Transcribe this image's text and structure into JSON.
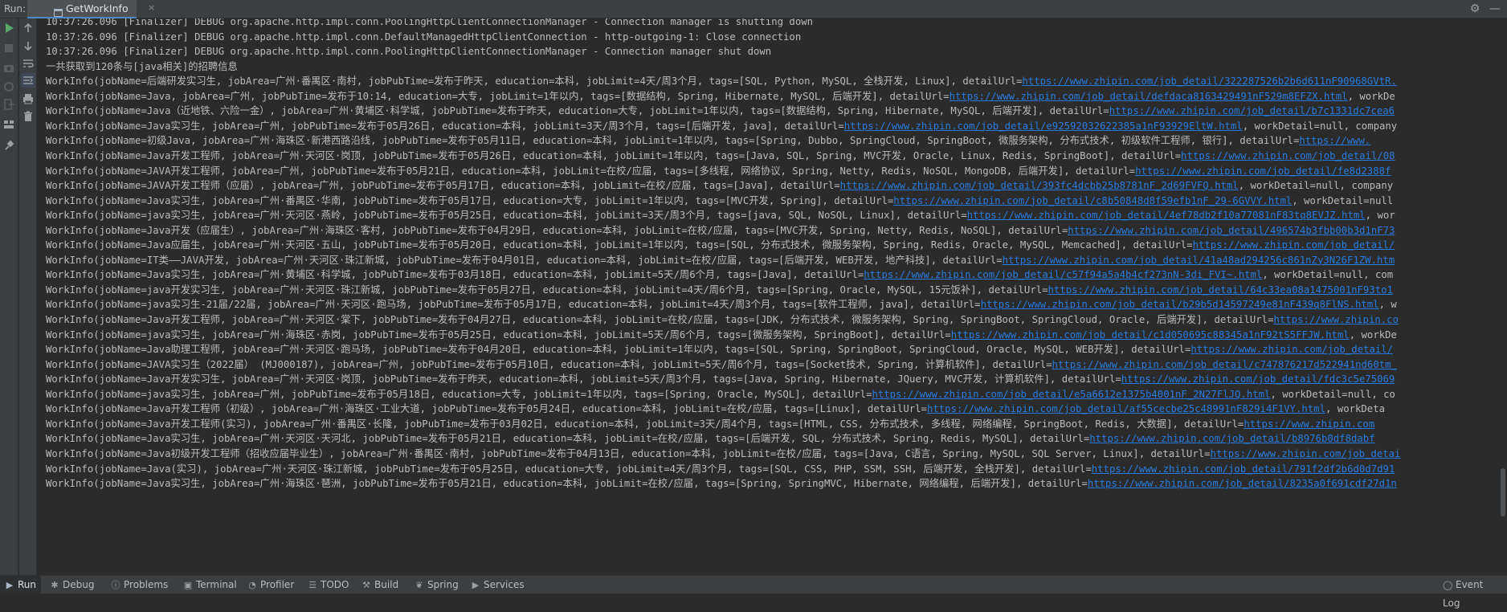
{
  "run_label": "Run:",
  "tab_title": "GetWorkInfo",
  "tab_close": "×",
  "bottom_tabs": [
    {
      "label": "Run",
      "icon": "play-icon"
    },
    {
      "label": "Debug",
      "icon": "bug-icon"
    },
    {
      "label": "Problems",
      "icon": "info-icon"
    },
    {
      "label": "Terminal",
      "icon": "terminal-icon"
    },
    {
      "label": "Profiler",
      "icon": "profiler-icon"
    },
    {
      "label": "TODO",
      "icon": "list-icon"
    },
    {
      "label": "Build",
      "icon": "hammer-icon"
    },
    {
      "label": "Spring",
      "icon": "leaf-icon"
    },
    {
      "label": "Services",
      "icon": "services-icon"
    }
  ],
  "event_log": "Event Log",
  "console_lines": [
    {
      "text": "10:37:26.096 [Finalizer] DEBUG org.apache.http.impl.conn.PoolingHttpClientConnectionManager - Connection manager is shutting down",
      "link": "",
      "after": ""
    },
    {
      "text": "10:37:26.096 [Finalizer] DEBUG org.apache.http.impl.conn.DefaultManagedHttpClientConnection - http-outgoing-1: Close connection",
      "link": "",
      "after": ""
    },
    {
      "text": "10:37:26.096 [Finalizer] DEBUG org.apache.http.impl.conn.PoolingHttpClientConnectionManager - Connection manager shut down",
      "link": "",
      "after": ""
    },
    {
      "text": "一共获取到120条与[java相关]的招聘信息",
      "link": "",
      "after": ""
    },
    {
      "text": "WorkInfo(jobName=后端研发实习生, jobArea=广州·番禺区·南村, jobPubTime=发布于昨天, education=本科, jobLimit=4天/周3个月, tags=[SQL, Python, MySQL, 全栈开发, Linux], detailUrl=",
      "link": "https://www.zhipin.com/job_detail/322287526b2b6d611nF90968GVtR.",
      "after": ""
    },
    {
      "text": "WorkInfo(jobName=Java, jobArea=广州, jobPubTime=发布于10:14, education=大专, jobLimit=1年以内, tags=[数据结构, Spring, Hibernate, MySQL, 后端开发], detailUrl=",
      "link": "https://www.zhipin.com/job_detail/defdaca8163429491nF529m8EFZX.html",
      "after": ", workDe"
    },
    {
      "text": "WorkInfo(jobName=Java（近地铁、六险一金）, jobArea=广州·黄埔区·科学城, jobPubTime=发布于昨天, education=大专, jobLimit=1年以内, tags=[数据结构, Spring, Hibernate, MySQL, 后端开发], detailUrl=",
      "link": "https://www.zhipin.com/job_detail/b7c1331dc7cea6",
      "after": ""
    },
    {
      "text": "WorkInfo(jobName=Java实习生, jobArea=广州, jobPubTime=发布于05月26日, education=本科, jobLimit=3天/周3个月, tags=[后端开发, java], detailUrl=",
      "link": "https://www.zhipin.com/job_detail/e92592032622385a1nF93929EltW.html",
      "after": ", workDetail=null, company"
    },
    {
      "text": "WorkInfo(jobName=初级Java, jobArea=广州·海珠区·新港西路沿线, jobPubTime=发布于05月11日, education=本科, jobLimit=1年以内, tags=[Spring, Dubbo, SpringCloud, SpringBoot, 微服务架构, 分布式技术, 初级软件工程师, 银行], detailUrl=",
      "link": "https://www.",
      "after": ""
    },
    {
      "text": "WorkInfo(jobName=Java开发工程师, jobArea=广州·天河区·岗顶, jobPubTime=发布于05月26日, education=本科, jobLimit=1年以内, tags=[Java, SQL, Spring, MVC开发, Oracle, Linux, Redis, SpringBoot], detailUrl=",
      "link": "https://www.zhipin.com/job_detail/08",
      "after": ""
    },
    {
      "text": "WorkInfo(jobName=JAVA开发工程师, jobArea=广州, jobPubTime=发布于05月21日, education=本科, jobLimit=在校/应届, tags=[多线程, 网络协议, Spring, Netty, Redis, NoSQL, MongoDB, 后端开发], detailUrl=",
      "link": "https://www.zhipin.com/job_detail/fe8d2388f",
      "after": ""
    },
    {
      "text": "WorkInfo(jobName=JAVA开发工程师（应届）, jobArea=广州, jobPubTime=发布于05月17日, education=本科, jobLimit=在校/应届, tags=[Java], detailUrl=",
      "link": "https://www.zhipin.com/job_detail/393fc4dcbb25b8781nF_2d69FVFQ.html",
      "after": ", workDetail=null, company"
    },
    {
      "text": "WorkInfo(jobName=Java实习生, jobArea=广州·番禺区·华南, jobPubTime=发布于05月17日, education=大专, jobLimit=1年以内, tags=[MVC开发, Spring], detailUrl=",
      "link": "https://www.zhipin.com/job_detail/c8b50848d8f59efb1nF_29-6GVVY.html",
      "after": ", workDetail=null"
    },
    {
      "text": "WorkInfo(jobName=java实习生, jobArea=广州·天河区·燕岭, jobPubTime=发布于05月25日, education=本科, jobLimit=3天/周3个月, tags=[java, SQL, NoSQL, Linux], detailUrl=",
      "link": "https://www.zhipin.com/job_detail/4ef78db2f10a77081nF83tq8EVJZ.html",
      "after": ", wor"
    },
    {
      "text": "WorkInfo(jobName=Java开发（应届生）, jobArea=广州·海珠区·客村, jobPubTime=发布于04月29日, education=本科, jobLimit=在校/应届, tags=[MVC开发, Spring, Netty, Redis, NoSQL], detailUrl=",
      "link": "https://www.zhipin.com/job_detail/496574b3fbb00b3d1nF73",
      "after": ""
    },
    {
      "text": "WorkInfo(jobName=Java应届生, jobArea=广州·天河区·五山, jobPubTime=发布于05月20日, education=本科, jobLimit=1年以内, tags=[SQL, 分布式技术, 微服务架构, Spring, Redis, Oracle, MySQL, Memcached], detailUrl=",
      "link": "https://www.zhipin.com/job_detail/",
      "after": ""
    },
    {
      "text": "WorkInfo(jobName=IT类——JAVA开发, jobArea=广州·天河区·珠江新城, jobPubTime=发布于04月01日, education=本科, jobLimit=在校/应届, tags=[后端开发, WEB开发, 地产科技], detailUrl=",
      "link": "https://www.zhipin.com/job_detail/41a48ad294256c861nZy3N26F1ZW.htm",
      "after": ""
    },
    {
      "text": "WorkInfo(jobName=Java实习生, jobArea=广州·黄埔区·科学城, jobPubTime=发布于03月18日, education=本科, jobLimit=5天/周6个月, tags=[Java], detailUrl=",
      "link": "https://www.zhipin.com/job_detail/c57f94a5a4b4cf273nN-3di_FVI~.html",
      "after": ", workDetail=null, com"
    },
    {
      "text": "WorkInfo(jobName=java开发实习生, jobArea=广州·天河区·珠江新城, jobPubTime=发布于05月27日, education=本科, jobLimit=4天/周6个月, tags=[Spring, Oracle, MySQL, 15元饭补], detailUrl=",
      "link": "https://www.zhipin.com/job_detail/64c33ea08a1475001nF93to1",
      "after": ""
    },
    {
      "text": "WorkInfo(jobName=java实习生-21届/22届, jobArea=广州·天河区·跑马场, jobPubTime=发布于05月17日, education=本科, jobLimit=4天/周3个月, tags=[软件工程师, java], detailUrl=",
      "link": "https://www.zhipin.com/job_detail/b29b5d14597249e81nF439q8FlNS.html",
      "after": ", w"
    },
    {
      "text": "WorkInfo(jobName=Java开发工程师, jobArea=广州·天河区·棠下, jobPubTime=发布于04月27日, education=本科, jobLimit=在校/应届, tags=[JDK, 分布式技术, 微服务架构, Spring, SpringBoot, SpringCloud, Oracle, 后端开发], detailUrl=",
      "link": "https://www.zhipin.co",
      "after": ""
    },
    {
      "text": "WorkInfo(jobName=java实习生, jobArea=广州·海珠区·赤岗, jobPubTime=发布于05月25日, education=本科, jobLimit=5天/周6个月, tags=[微服务架构, SpringBoot], detailUrl=",
      "link": "https://www.zhipin.com/job_detail/c1d050695c88345a1nF92tS5FFJW.html",
      "after": ", workDe"
    },
    {
      "text": "WorkInfo(jobName=Java助理工程师, jobArea=广州·天河区·跑马场, jobPubTime=发布于04月20日, education=本科, jobLimit=1年以内, tags=[SQL, Spring, SpringBoot, SpringCloud, Oracle, MySQL, WEB开发], detailUrl=",
      "link": "https://www.zhipin.com/job_detail/",
      "after": ""
    },
    {
      "text": "WorkInfo(jobName=JAVA实习生（2022届） (MJ000187), jobArea=广州, jobPubTime=发布于05月10日, education=本科, jobLimit=5天/周6个月, tags=[Socket技术, Spring, 计算机软件], detailUrl=",
      "link": "https://www.zhipin.com/job_detail/c747876217d522941nd60tm_",
      "after": ""
    },
    {
      "text": "WorkInfo(jobName=Java开发实习生, jobArea=广州·天河区·岗顶, jobPubTime=发布于昨天, education=本科, jobLimit=5天/周3个月, tags=[Java, Spring, Hibernate, JQuery, MVC开发, 计算机软件], detailUrl=",
      "link": "https://www.zhipin.com/job_detail/fdc3c5e75069",
      "after": ""
    },
    {
      "text": "WorkInfo(jobName=java实习生, jobArea=广州, jobPubTime=发布于05月18日, education=大专, jobLimit=1年以内, tags=[Spring, Oracle, MySQL], detailUrl=",
      "link": "https://www.zhipin.com/job_detail/e5a6612e1375b4001nF_2N27FlJQ.html",
      "after": ", workDetail=null, co"
    },
    {
      "text": "WorkInfo(jobName=Java开发工程师（初级）, jobArea=广州·海珠区·工业大道, jobPubTime=发布于05月24日, education=本科, jobLimit=在校/应届, tags=[Linux], detailUrl=",
      "link": "https://www.zhipin.com/job_detail/af55cecbe25c48991nF829i4F1VY.html",
      "after": ", workDeta"
    },
    {
      "text": "WorkInfo(jobName=Java开发工程师(实习), jobArea=广州·番禺区·长隆, jobPubTime=发布于03月02日, education=本科, jobLimit=3天/周4个月, tags=[HTML, CSS, 分布式技术, 多线程, 网络编程, SpringBoot, Redis, 大数据], detailUrl=",
      "link": "https://www.zhipin.com",
      "after": ""
    },
    {
      "text": "WorkInfo(jobName=Java实习生, jobArea=广州·天河区·天河北, jobPubTime=发布于05月21日, education=本科, jobLimit=在校/应届, tags=[后端开发, SQL, 分布式技术, Spring, Redis, MySQL], detailUrl=",
      "link": "https://www.zhipin.com/job_detail/b8976b0df8dabf",
      "after": ""
    },
    {
      "text": "WorkInfo(jobName=Java初级开发工程师（招收应届毕业生）, jobArea=广州·番禺区·南村, jobPubTime=发布于04月13日, education=本科, jobLimit=在校/应届, tags=[Java, C语言, Spring, MySQL, SQL Server, Linux], detailUrl=",
      "link": "https://www.zhipin.com/job_detai",
      "after": ""
    },
    {
      "text": "WorkInfo(jobName=Java(实习), jobArea=广州·天河区·珠江新城, jobPubTime=发布于05月25日, education=大专, jobLimit=4天/周3个月, tags=[SQL, CSS, PHP, SSM, SSH, 后端开发, 全栈开发], detailUrl=",
      "link": "https://www.zhipin.com/job_detail/791f2df2b6d0d7d91",
      "after": ""
    },
    {
      "text": "WorkInfo(jobName=Java实习生, jobArea=广州·海珠区·琶洲, jobPubTime=发布于05月21日, education=本科, jobLimit=在校/应届, tags=[Spring, SpringMVC, Hibernate, 网络编程, 后端开发], detailUrl=",
      "link": "https://www.zhipin.com/job_detail/8235a0f691cdf27d1n",
      "after": ""
    }
  ]
}
